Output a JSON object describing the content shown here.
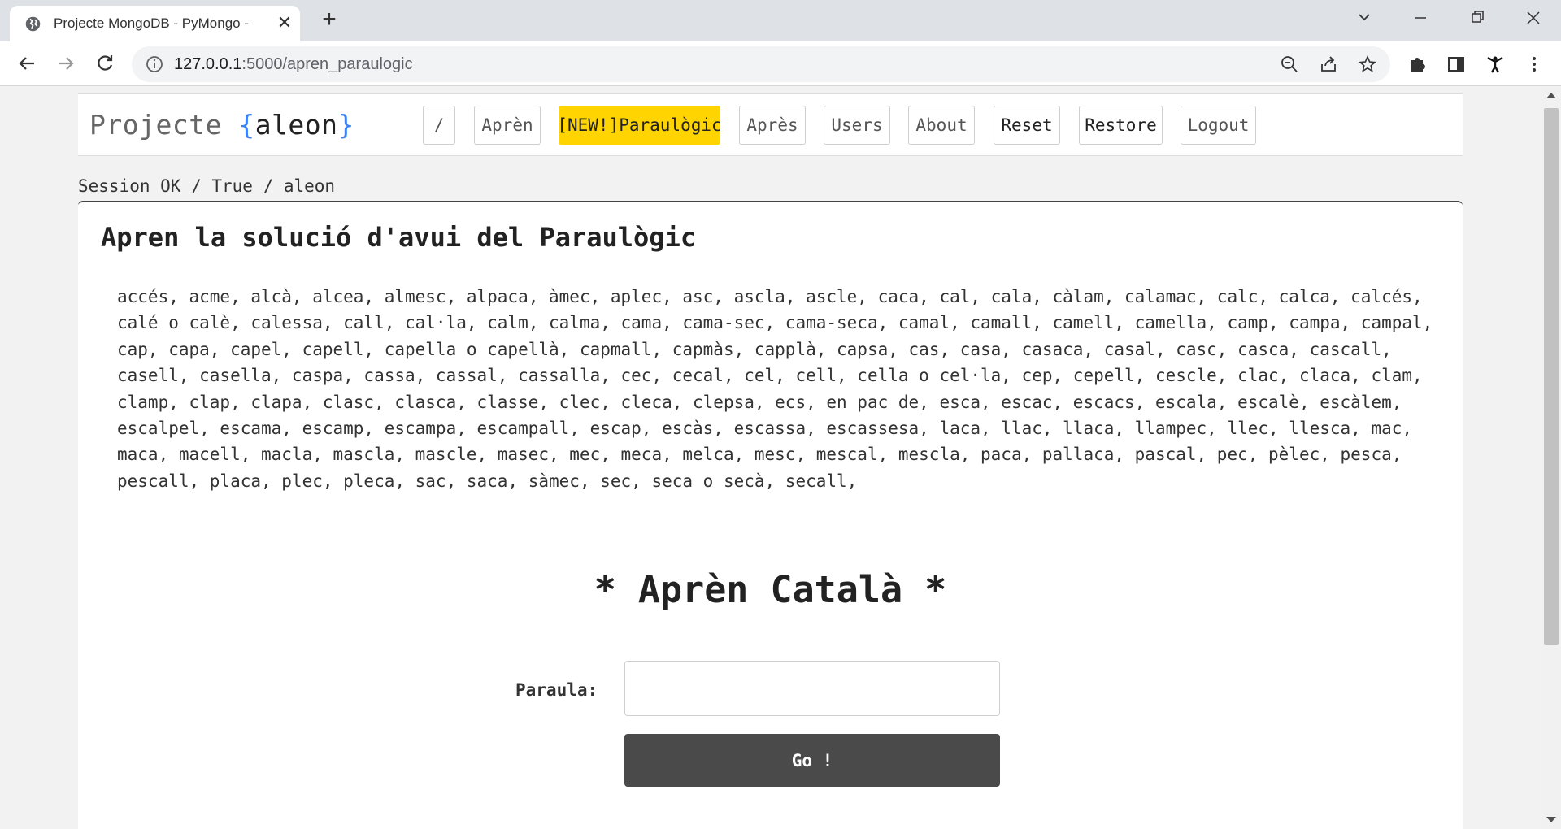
{
  "browser": {
    "tab_title": "Projecte MongoDB - PyMongo -",
    "url_host": "127.0.0.1",
    "url_rest": ":5000/apren_paraulogic"
  },
  "header": {
    "brand_prefix": "Projecte ",
    "brand_open": "{",
    "brand_user": "aleon",
    "brand_close": "}",
    "nav": {
      "home": "/",
      "apren": "Aprèn",
      "paraulogic": "[NEW!]Paraulògic",
      "apres": "Après",
      "users": "Users",
      "about": "About",
      "reset": "Reset",
      "restore": "Restore",
      "logout": "Logout"
    }
  },
  "session_line": "Session OK / True / aleon",
  "main": {
    "title": "Apren la solució d'avui del Paraulògic",
    "words": "accés, acme, alcà, alcea, almesc, alpaca, àmec, aplec, asc, ascla, ascle, caca, cal, cala, càlam, calamac, calc, calca, calcés, calé o calè, calessa, call, cal·la, calm, calma, cama, cama-sec, cama-seca, camal, camall, camell, camella, camp, campa, campal, cap, capa, capel, capell, capella o capellà, capmall, capmàs, capplà, capsa, cas, casa, casaca, casal, casc, casca, cascall, casell, casella, caspa, cassa, cassal, cassalla, cec, cecal, cel, cell, cella o cel·la, cep, cepell, cescle, clac, claca, clam, clamp, clap, clapa, clasc, clasca, classe, clec, cleca, clepsa, ecs, en pac de, esca, escac, escacs, escala, escalè, escàlem, escalpel, escama, escamp, escampa, escampall, escap, escàs, escassa, escassesa, laca, llac, llaca, llampec, llec, llesca, mac, maca, macell, macla, mascla, mascle, masec, mec, meca, melca, mesc, mescal, mescla, paca, pallaca, pascal, pec, pèlec, pesca, pescall, placa, plec, pleca, sac, saca, sàmec, sec, seca o secà, secall,",
    "big_title": "* Aprèn Català *",
    "form_label": "Paraula:",
    "input_value": "",
    "go_label": "Go !",
    "tail": "..."
  }
}
